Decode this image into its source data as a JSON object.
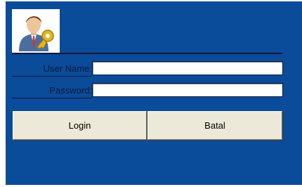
{
  "login_form": {
    "icon": "user-key-icon",
    "user_name_label": "User Name:",
    "user_name_value": "",
    "password_label": "Password:",
    "password_value": "",
    "login_label": "Login",
    "cancel_label": "Batal"
  },
  "colors": {
    "window_background": "#0a4b9a",
    "button_face": "#ece9d8",
    "label_text": "#0b1a38"
  }
}
